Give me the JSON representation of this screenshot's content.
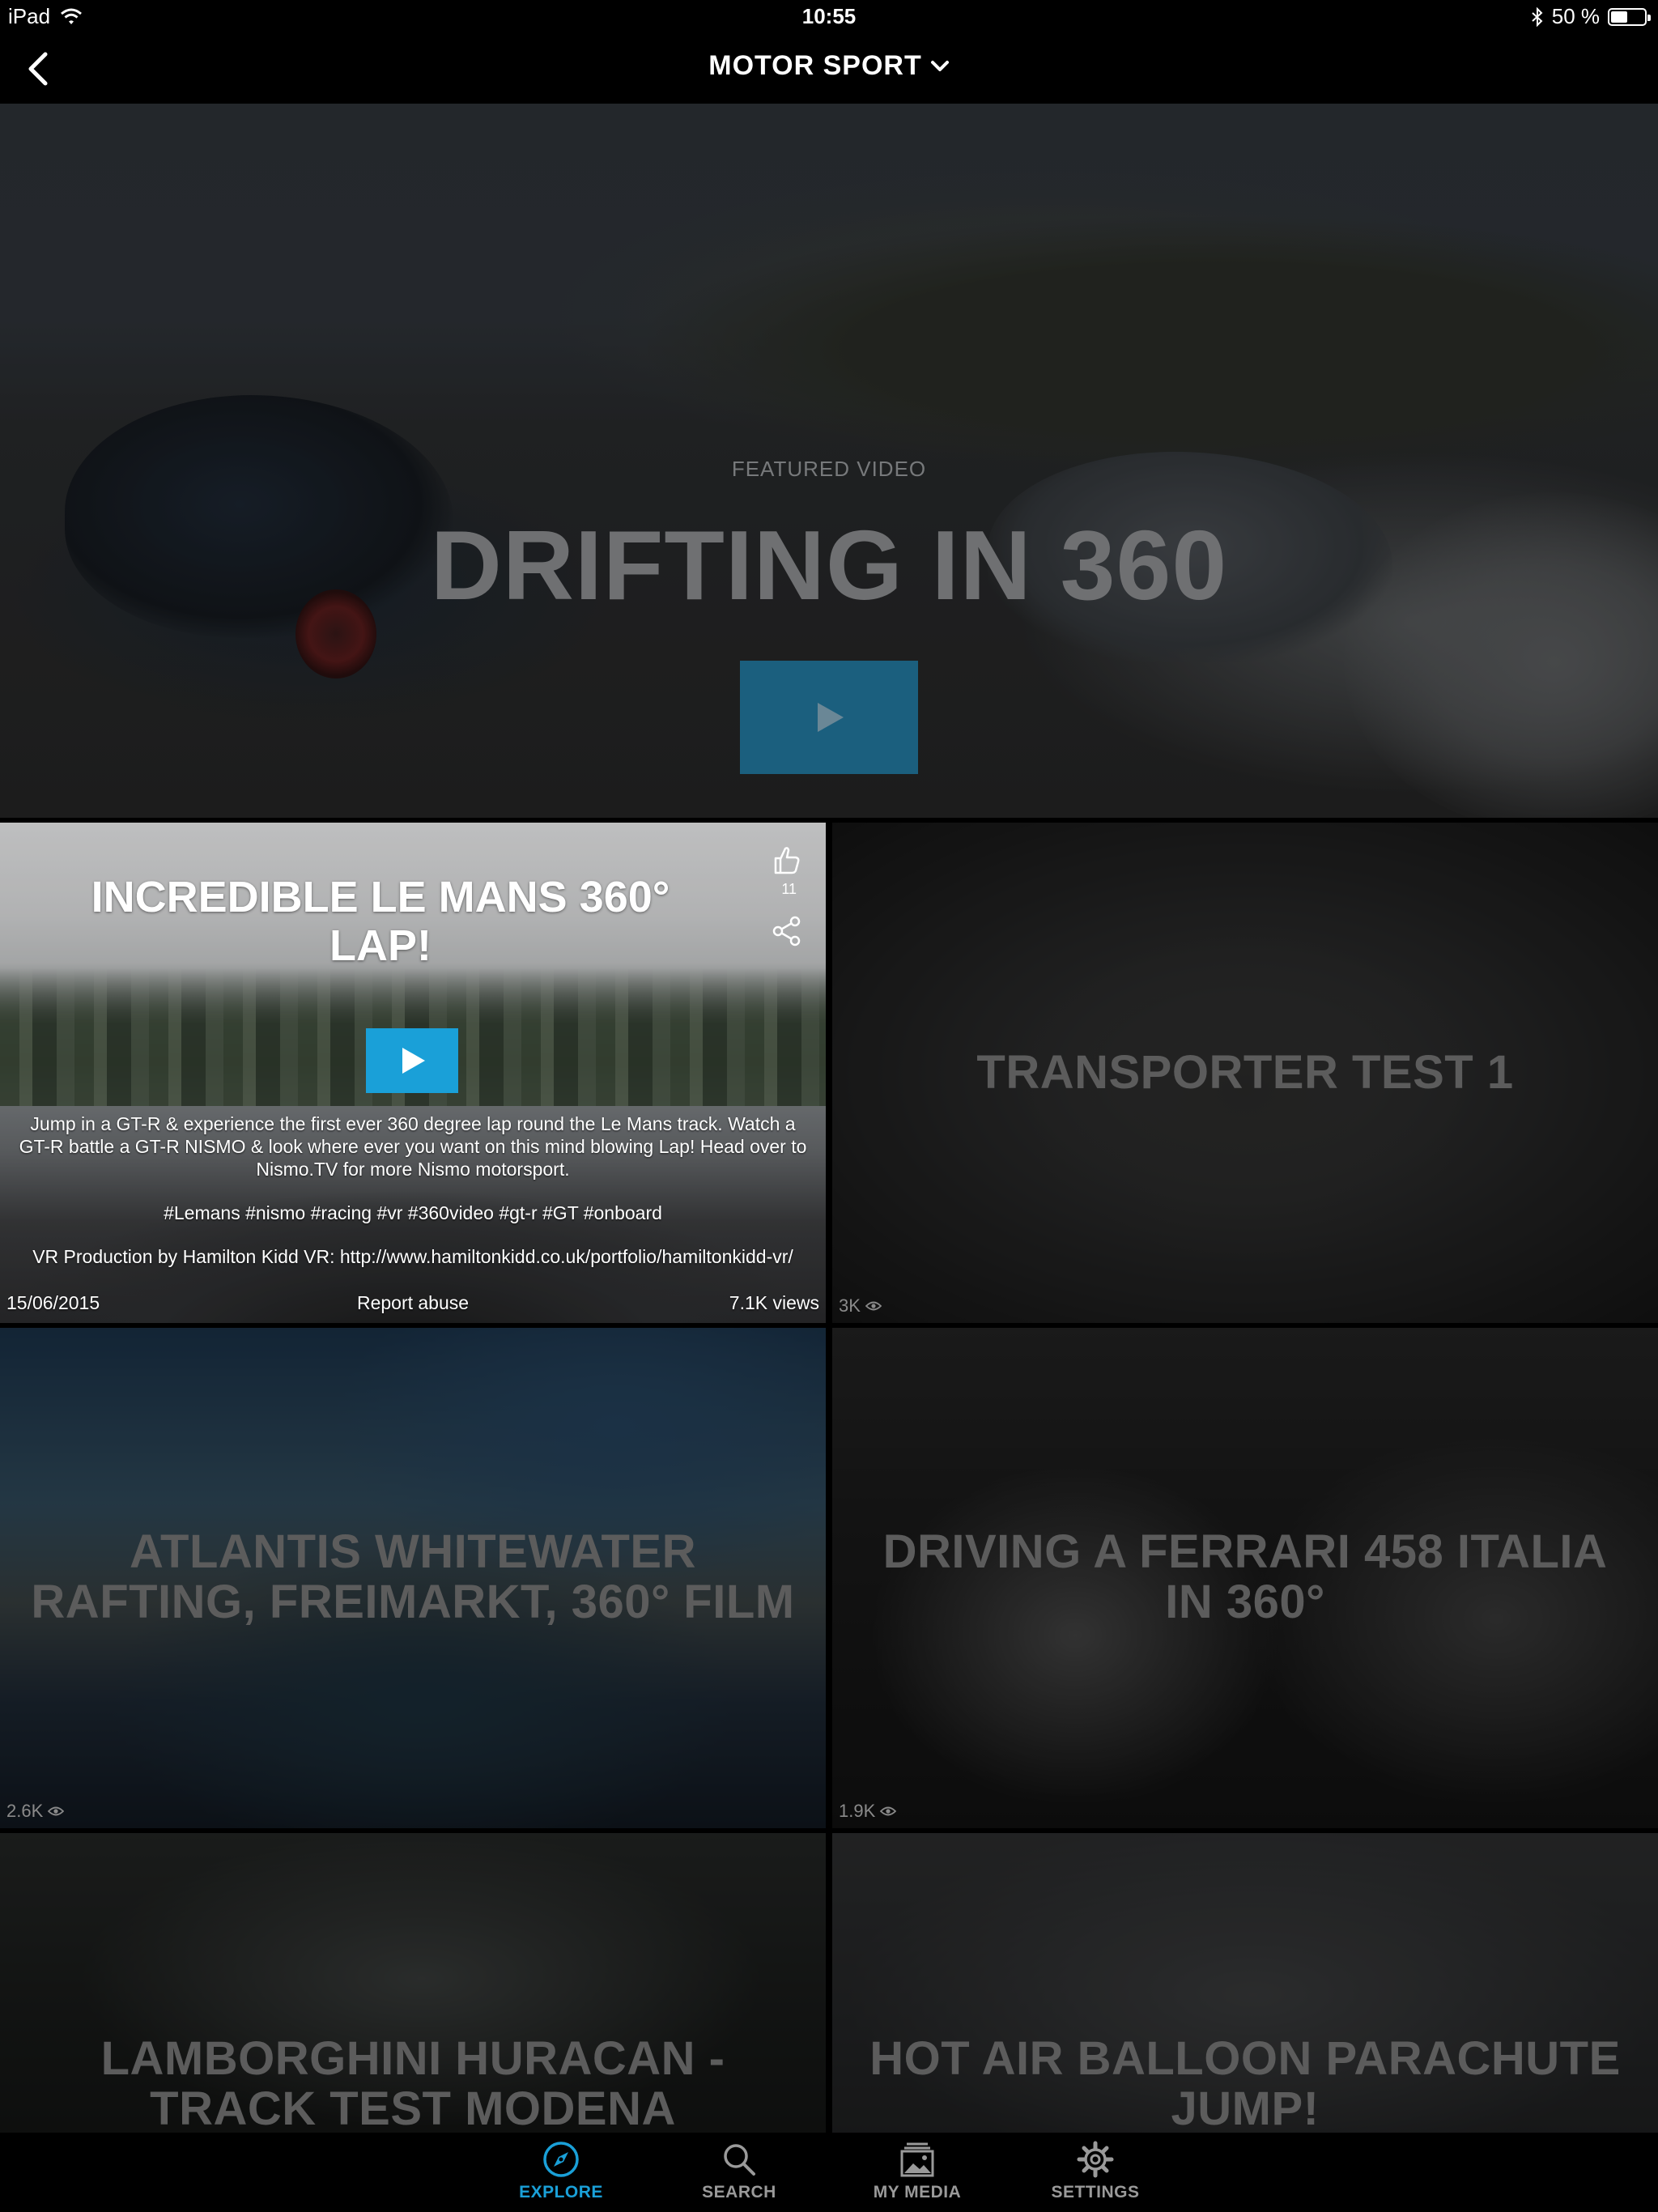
{
  "status_bar": {
    "device": "iPad",
    "time": "10:55",
    "battery_percent": "50 %",
    "battery_level": 0.5
  },
  "nav": {
    "title": "MOTOR SPORT"
  },
  "featured": {
    "label": "FEATURED VIDEO",
    "title": "DRIFTING IN 360"
  },
  "expanded_video": {
    "title": "INCREDIBLE LE MANS 360° LAP!",
    "likes": "11",
    "description": "Jump in a GT-R & experience the first ever 360 degree lap round the Le Mans track. Watch a GT-R battle a GT-R NISMO & look where ever you want on this mind blowing Lap! Head over to Nismo.TV for more Nismo motorsport.",
    "tags": "#Lemans #nismo #racing #vr #360video #gt-r #GT #onboard",
    "credit": "VR Production by Hamilton Kidd VR: http://www.hamiltonkidd.co.uk/portfolio/hamiltonkidd-vr/",
    "date": "15/06/2015",
    "report": "Report abuse",
    "views": "7.1K views"
  },
  "videos": [
    {
      "title": "TRANSPORTER TEST 1",
      "views": "3K"
    },
    {
      "title": "ATLANTIS WHITEWATER RAFTING, FREIMARKT, 360° FILM",
      "views": "2.6K"
    },
    {
      "title": "DRIVING A FERRARI 458 ITALIA IN 360°",
      "views": "1.9K"
    },
    {
      "title": "LAMBORGHINI HURACAN - TRACK TEST  MODENA"
    },
    {
      "title": "HOT AIR BALLOON PARACHUTE JUMP!"
    }
  ],
  "tabs": [
    {
      "label": "EXPLORE",
      "icon": "compass-icon",
      "active": true
    },
    {
      "label": "SEARCH",
      "icon": "search-icon"
    },
    {
      "label": "MY MEDIA",
      "icon": "media-stack-icon"
    },
    {
      "label": "SETTINGS",
      "icon": "gear-icon"
    }
  ],
  "colors": {
    "accent": "#1aa0d8",
    "background": "#000000"
  }
}
